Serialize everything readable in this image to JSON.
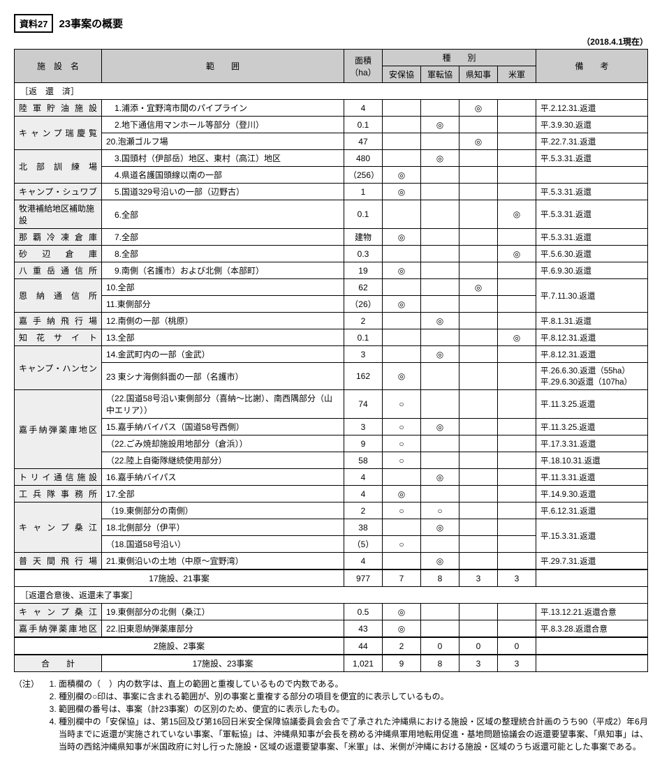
{
  "doc_label": "資料27",
  "doc_title": "23事案の概要",
  "as_of": "（2018.4.1現在）",
  "headers": {
    "facility": "施　設　名",
    "range": "範　　囲",
    "area": "面積（ha）",
    "type": "種　　別",
    "t1": "安保協",
    "t2": "軍転協",
    "t3": "県知事",
    "t4": "米軍",
    "remarks": "備　　考"
  },
  "section1": "［返　還　済］",
  "rows1": [
    {
      "f": "陸軍貯油施設",
      "r": "　1.浦添・宜野湾市間のパイプライン",
      "a": "4",
      "m": [
        "",
        "",
        "◎",
        ""
      ],
      "rem": "平.2.12.31.返還",
      "fr": 1
    },
    {
      "f": "キャンプ瑞慶覧",
      "r": "　2.地下通信用マンホール等部分（登川）",
      "a": "0.1",
      "m": [
        "",
        "◎",
        "",
        ""
      ],
      "rem": "平.3.9.30.返還",
      "fr": 2
    },
    {
      "f": "",
      "r": "20.泡瀬ゴルフ場",
      "a": "47",
      "m": [
        "",
        "",
        "◎",
        ""
      ],
      "rem": "平.22.7.31.返還"
    },
    {
      "f": "北部訓練場",
      "r": "　3.国頭村（伊部岳）地区、東村（高江）地区",
      "a": "480",
      "m": [
        "",
        "◎",
        "",
        ""
      ],
      "rem": "平.5.3.31.返還",
      "fr": 2
    },
    {
      "f": "",
      "r": "　4.県道名護国頭線以南の一部",
      "a": "（256）",
      "m": [
        "◎",
        "",
        "",
        ""
      ],
      "rem": ""
    },
    {
      "f": "キャンプ・シュワブ",
      "r": "　5.国道329号沿いの一部（辺野古）",
      "a": "1",
      "m": [
        "◎",
        "",
        "",
        ""
      ],
      "rem": "平.5.3.31.返還",
      "fr": 1
    },
    {
      "f": "牧港補給地区補助施設",
      "r": "　6.全部",
      "a": "0.1",
      "m": [
        "",
        "",
        "",
        "◎"
      ],
      "rem": "平.5.3.31.返還",
      "fr": 1,
      "nojust": true
    },
    {
      "f": "那覇冷凍倉庫",
      "r": "　7.全部",
      "a": "建物",
      "m": [
        "◎",
        "",
        "",
        ""
      ],
      "rem": "平.5.3.31.返還",
      "fr": 1
    },
    {
      "f": "砂辺倉庫",
      "r": "　8.全部",
      "a": "0.3",
      "m": [
        "",
        "",
        "",
        "◎"
      ],
      "rem": "平.5.6.30.返還",
      "fr": 1
    },
    {
      "f": "八重岳通信所",
      "r": "　9.南側（名護市）および北側（本部町）",
      "a": "19",
      "m": [
        "◎",
        "",
        "",
        ""
      ],
      "rem": "平.6.9.30.返還",
      "fr": 1
    },
    {
      "f": "恩納通信所",
      "r": "10.全部",
      "a": "62",
      "m": [
        "",
        "",
        "◎",
        ""
      ],
      "rem": "平.7.11.30.返還",
      "fr": 2,
      "rr": 2
    },
    {
      "f": "",
      "r": "11.東側部分",
      "a": "（26）",
      "m": [
        "◎",
        "",
        "",
        ""
      ]
    },
    {
      "f": "嘉手納飛行場",
      "r": "12.南側の一部（桃原）",
      "a": "2",
      "m": [
        "",
        "◎",
        "",
        ""
      ],
      "rem": "平.8.1.31.返還",
      "fr": 1
    },
    {
      "f": "知花サイト",
      "r": "13.全部",
      "a": "0.1",
      "m": [
        "",
        "",
        "",
        "◎"
      ],
      "rem": "平.8.12.31.返還",
      "fr": 1
    },
    {
      "f": "キャンプ・ハンセン",
      "r": "14.金武町内の一部（金武）",
      "a": "3",
      "m": [
        "",
        "◎",
        "",
        ""
      ],
      "rem": "平.8.12.31.返還",
      "fr": 2
    },
    {
      "f": "",
      "r": "23 東シナ海側斜面の一部（名護市）",
      "a": "162",
      "m": [
        "◎",
        "",
        "",
        ""
      ],
      "rem": "平.26.6.30.返還（55ha）平.29.6.30返還（107ha）"
    },
    {
      "f": "嘉手納弾薬庫地区",
      "r": "（22.国道58号沿い東側部分（喜納～比謝）、南西隅部分（山中エリア））",
      "a": "74",
      "m": [
        "○",
        "",
        "",
        ""
      ],
      "rem": "平.11.3.25.返還",
      "fr": 4
    },
    {
      "f": "",
      "r": "15.嘉手納バイパス（国道58号西側）",
      "a": "3",
      "m": [
        "○",
        "◎",
        "",
        ""
      ],
      "rem": "平.11.3.25.返還"
    },
    {
      "f": "",
      "r": "（22.ごみ焼却施設用地部分（倉浜））",
      "a": "9",
      "m": [
        "○",
        "",
        "",
        ""
      ],
      "rem": "平.17.3.31.返還"
    },
    {
      "f": "",
      "r": "（22.陸上自衛隊継続使用部分）",
      "a": "58",
      "m": [
        "○",
        "",
        "",
        ""
      ],
      "rem": "平.18.10.31.返還"
    },
    {
      "f": "トリイ通信施設",
      "r": "16.嘉手納バイパス",
      "a": "4",
      "m": [
        "",
        "◎",
        "",
        ""
      ],
      "rem": "平.11.3.31.返還",
      "fr": 1
    },
    {
      "f": "工兵隊事務所",
      "r": "17.全部",
      "a": "4",
      "m": [
        "◎",
        "",
        "",
        ""
      ],
      "rem": "平.14.9.30.返還",
      "fr": 1
    },
    {
      "f": "キャンプ桑江",
      "r": "（19.東側部分の南側）",
      "a": "2",
      "m": [
        "○",
        "○",
        "",
        ""
      ],
      "rem": "平.6.12.31.返還",
      "fr": 3
    },
    {
      "f": "",
      "r": " 18.北側部分（伊平）",
      "a": "38",
      "m": [
        "",
        "◎",
        "",
        ""
      ],
      "rem": "平.15.3.31.返還",
      "rr": 2
    },
    {
      "f": "",
      "r": "（18.国道58号沿い）",
      "a": "（5）",
      "m": [
        "○",
        "",
        "",
        ""
      ]
    },
    {
      "f": "普天間飛行場",
      "r": " 21.東側沿いの土地（中原～宜野湾）",
      "a": "4",
      "m": [
        "",
        "◎",
        "",
        ""
      ],
      "rem": "平.29.7.31.返還",
      "fr": 1
    }
  ],
  "sum1": {
    "label": "17施設、21事案",
    "a": "977",
    "m": [
      "7",
      "8",
      "3",
      "3"
    ],
    "rem": ""
  },
  "section2": "［返還合意後、返還未了事案］",
  "rows2": [
    {
      "f": "キャンプ桑江",
      "r": "19.東側部分の北側（桑江）",
      "a": "0.5",
      "m": [
        "◎",
        "",
        "",
        ""
      ],
      "rem": "平.13.12.21.返還合意",
      "fr": 1
    },
    {
      "f": "嘉手納弾薬庫地区",
      "r": "22.旧東恩納弾薬庫部分",
      "a": "43",
      "m": [
        "◎",
        "",
        "",
        ""
      ],
      "rem": "平.8.3.28.返還合意",
      "fr": 1
    }
  ],
  "sum2": {
    "label": "2施設、2事案",
    "a": "44",
    "m": [
      "2",
      "0",
      "0",
      "0"
    ],
    "rem": ""
  },
  "total": {
    "label": "合　　計",
    "r": "17施設、23事案",
    "a": "1,021",
    "m": [
      "9",
      "8",
      "3",
      "3"
    ],
    "rem": ""
  },
  "notes_label": "（注）",
  "notes": [
    "面積欄の（　）内の数字は、直上の範囲と重複しているもので内数である。",
    "種別欄の○印は、事案に含まれる範囲が、別の事案と重複する部分の項目を便宜的に表示しているもの。",
    "範囲欄の番号は、事案（計23事案）の区別のため、便宜的に表示したもの。",
    "種別欄中の「安保協」は、第15回及び第16回日米安全保障協議委員会会合で了承された沖縄県における施設・区域の整理統合計画のうち90（平成2）年6月当時までに返還が実施されていない事案、「軍転協」は、沖縄県知事が会長を務める沖縄県軍用地転用促進・基地問題協議会の返還要望事案、「県知事」は、当時の西銘沖縄県知事が米国政府に対し行った施設・区域の返還要望事案、「米軍」は、米側が沖縄における施設・区域のうち返還可能とした事案である。"
  ]
}
